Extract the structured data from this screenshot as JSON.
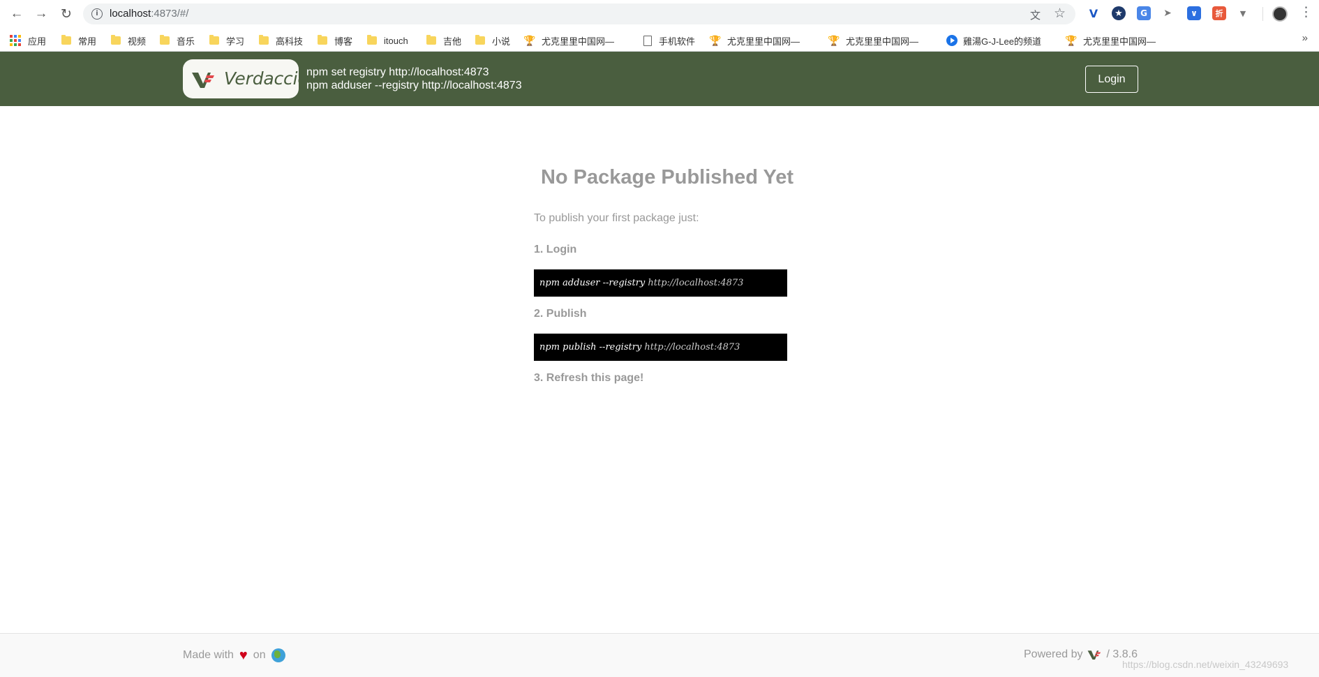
{
  "browser": {
    "url_host": "localhost",
    "url_rest": ":4873/#/",
    "bookmarks": [
      {
        "label": "应用",
        "icon": "apps-grid-icon"
      },
      {
        "label": "常用",
        "icon": "folder-icon"
      },
      {
        "label": "视频",
        "icon": "folder-icon"
      },
      {
        "label": "音乐",
        "icon": "folder-icon"
      },
      {
        "label": "学习",
        "icon": "folder-icon"
      },
      {
        "label": "高科技",
        "icon": "folder-icon"
      },
      {
        "label": "博客",
        "icon": "folder-icon"
      },
      {
        "label": "itouch",
        "icon": "folder-icon"
      },
      {
        "label": "吉他",
        "icon": "folder-icon"
      },
      {
        "label": "小说",
        "icon": "folder-icon"
      },
      {
        "label": "尤克里里中国网—",
        "icon": "trophy-icon"
      },
      {
        "label": "手机软件",
        "icon": "document-icon"
      },
      {
        "label": "尤克里里中国网—",
        "icon": "trophy-icon"
      },
      {
        "label": "尤克里里中国网—",
        "icon": "trophy-icon"
      },
      {
        "label": "雞湯G-J-Lee的频道",
        "icon": "channel-icon"
      },
      {
        "label": "尤克里里中国网—",
        "icon": "trophy-icon"
      }
    ],
    "more_label": "»"
  },
  "header": {
    "logo_text": "Verdaccio",
    "registry_line1": "npm set registry http://localhost:4873",
    "registry_line2": "npm adduser --registry http://localhost:4873",
    "login_label": "Login"
  },
  "main": {
    "title": "No Package Published Yet",
    "intro": "To publish your first package just:",
    "step1": "1. Login",
    "step1_cmd": "npm adduser --registry ",
    "step1_url": "http://localhost:4873",
    "step2": "2. Publish",
    "step2_cmd": "npm publish --registry ",
    "step2_url": "http://localhost:4873",
    "step3": "3. Refresh this page!"
  },
  "footer": {
    "made_with": "Made with",
    "on": "on",
    "powered_by": "Powered by",
    "version": "/ 3.8.6"
  },
  "watermark": "https://blog.csdn.net/weixin_43249693",
  "colors": {
    "header_bg": "#4a5e3f",
    "logo_red": "#e2474b",
    "text_muted": "#999999",
    "code_bg": "#000000"
  }
}
